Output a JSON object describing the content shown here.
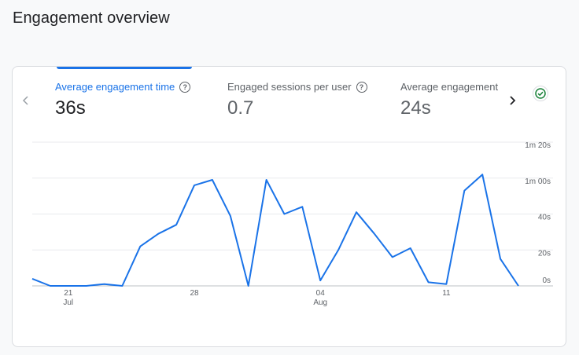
{
  "page": {
    "title": "Engagement overview"
  },
  "metrics": [
    {
      "label": "Average engagement time",
      "value": "36s",
      "active": true
    },
    {
      "label": "Engaged sessions per user",
      "value": "0.7",
      "active": false
    },
    {
      "label": "Average engagement",
      "value": "24s",
      "active": false
    }
  ],
  "icons": {
    "help": "help-circle-icon",
    "prev": "chevron-left-icon",
    "next": "chevron-right-icon",
    "check": "check-circle-icon"
  },
  "colors": {
    "accent": "#1a73e8",
    "line": "#1a73e8",
    "check": "#188038"
  },
  "chart_data": {
    "type": "line",
    "title": "",
    "xlabel": "",
    "ylabel": "",
    "x_ticks": [
      {
        "day": "21",
        "month": "Jul"
      },
      {
        "day": "28",
        "month": ""
      },
      {
        "day": "04",
        "month": "Aug"
      },
      {
        "day": "11",
        "month": ""
      }
    ],
    "y_ticks": [
      "1m 20s",
      "1m 00s",
      "40s",
      "20s",
      "0s"
    ],
    "y_tick_values": [
      80,
      60,
      40,
      20,
      0
    ],
    "ylim": [
      0,
      80
    ],
    "grid": true,
    "series": [
      {
        "values": [
          4,
          0,
          0,
          0,
          1,
          0,
          22,
          29,
          34,
          56,
          59,
          39,
          0,
          59,
          40,
          44,
          3,
          20,
          41,
          29,
          16,
          21,
          2,
          1,
          53,
          62,
          15,
          0
        ]
      }
    ]
  }
}
